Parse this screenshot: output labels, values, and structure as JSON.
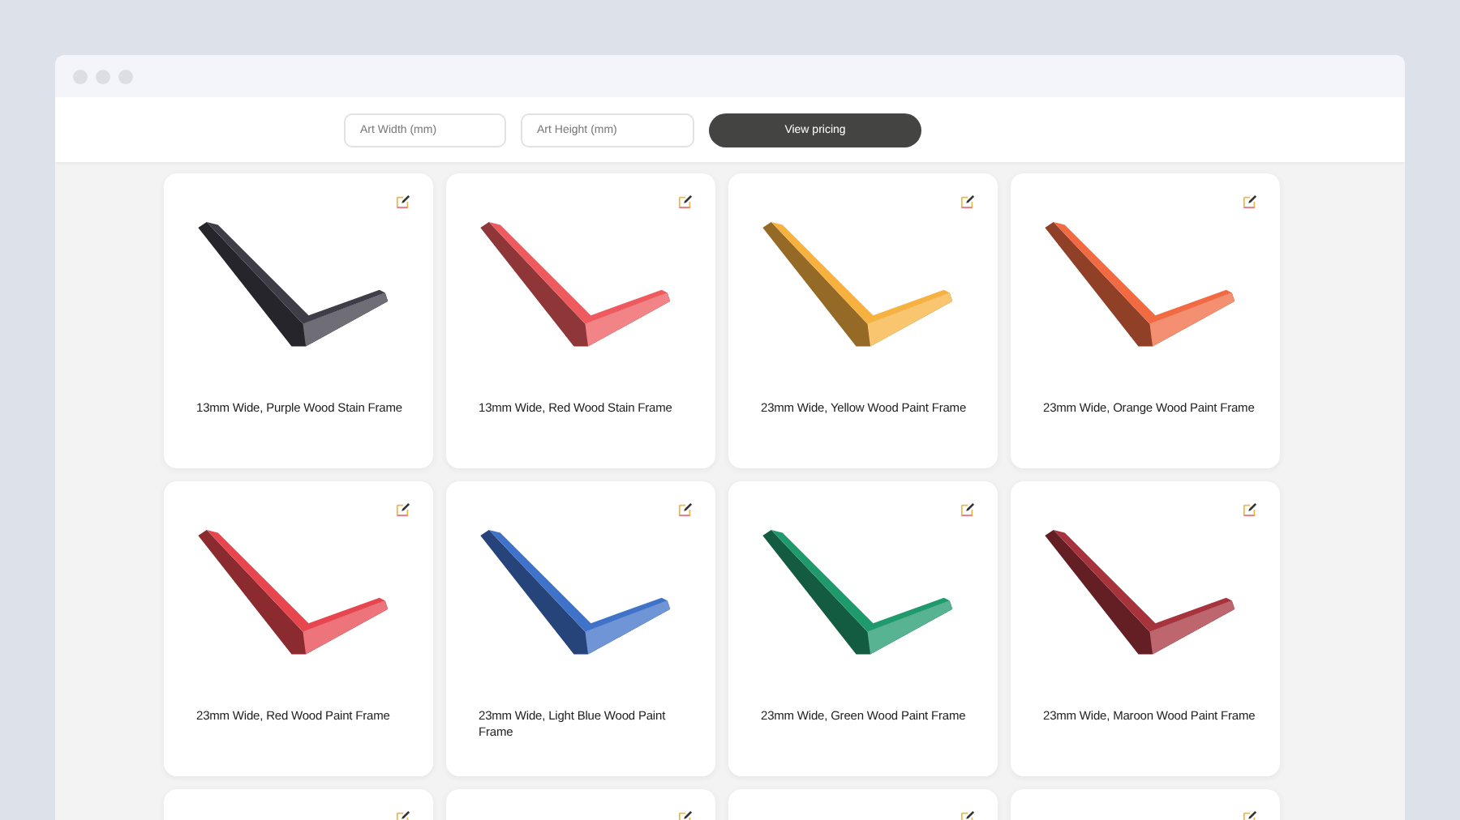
{
  "toolbar": {
    "width_field": {
      "placeholder": "Art Width (mm)"
    },
    "height_field": {
      "placeholder": "Art Height (mm)"
    },
    "button": "View pricing"
  },
  "cards": [
    {
      "kind": "frame",
      "title": "13mm Wide, Purple Wood Stain Frame",
      "color": "#3f3e48"
    },
    {
      "kind": "frame",
      "title": "13mm Wide, Red Wood Stain Frame",
      "color": "#ee5a5e"
    },
    {
      "kind": "frame",
      "title": "23mm Wide, Yellow Wood Paint Frame",
      "color": "#f7b13f"
    },
    {
      "kind": "frame",
      "title": "23mm Wide, Orange Wood Paint Frame",
      "color": "#f26a42"
    },
    {
      "kind": "frame",
      "title": "23mm Wide, Red Wood Paint Frame",
      "color": "#e8464f"
    },
    {
      "kind": "frame",
      "title": "23mm Wide, Light Blue Wood Paint Frame",
      "color": "#3f72c9"
    },
    {
      "kind": "frame",
      "title": "23mm Wide, Green Wood Paint Frame",
      "color": "#1f9a6c"
    },
    {
      "kind": "frame",
      "title": "23mm Wide, Maroon Wood Paint Frame",
      "color": "#a7333d"
    },
    {
      "kind": "cut"
    },
    {
      "kind": "cut"
    },
    {
      "kind": "cut"
    },
    {
      "kind": "cut"
    }
  ]
}
